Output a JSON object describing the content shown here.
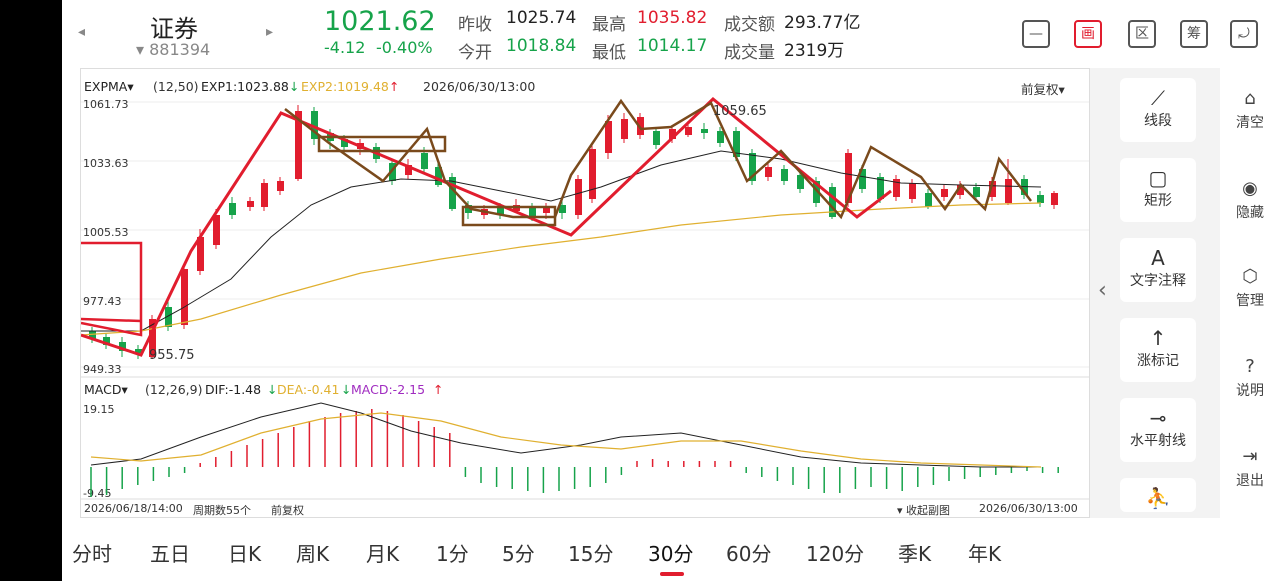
{
  "header": {
    "prev_arrow": "◂",
    "next_arrow": "▸",
    "name": "证券",
    "code": "▾ 881394",
    "price": "1021.62",
    "change": "-4.12",
    "change_pct": "-0.40%",
    "stats": [
      {
        "label": "昨收",
        "value": "1025.74",
        "color": "k"
      },
      {
        "label": "最高",
        "value": "1035.82",
        "color": "r"
      },
      {
        "label": "成交额",
        "value": "293.77亿",
        "color": "k"
      },
      {
        "label": "今开",
        "value": "1018.84",
        "color": "g"
      },
      {
        "label": "最低",
        "value": "1014.17",
        "color": "g"
      },
      {
        "label": "成交量",
        "value": "2319万",
        "color": "k"
      }
    ],
    "tools": [
      {
        "name": "minimize-icon",
        "glyph": "—"
      },
      {
        "name": "draw-icon",
        "glyph": "画"
      },
      {
        "name": "range-icon",
        "glyph": "区"
      },
      {
        "name": "chip-icon",
        "glyph": "筹"
      },
      {
        "name": "rotate-icon",
        "glyph": "⤾"
      }
    ]
  },
  "main_chart": {
    "indicator": "EXPMA▾",
    "params": "(12,50)",
    "exp1": "EXP1:1023.88",
    "exp1_arrow": "↓",
    "exp2": "EXP2:1019.48",
    "exp2_arrow": "↑",
    "datetime": "2026/06/30/13:00",
    "adjust": "前复权▾",
    "y_ticks": [
      "1061.73",
      "1033.63",
      "1005.53",
      "977.43",
      "949.33"
    ],
    "high_label": "1059.65",
    "low_label": "955.75"
  },
  "macd_chart": {
    "indicator": "MACD▾",
    "params": "(12,26,9)",
    "dif": "DIF:-1.48",
    "dif_arrow": "↓",
    "dea": "DEA:-0.41",
    "dea_arrow": "↓",
    "macd": "MACD:-2.15",
    "macd_arrow": "↑",
    "y_top": "19.15",
    "y_bottom": "-9.45"
  },
  "footer_bar": {
    "start_time": "2026/06/18/14:00",
    "period_count": "周期数55个",
    "adjust": "前复权",
    "collapse": "▾ 收起副图",
    "end_time": "2026/06/30/13:00"
  },
  "draw_tools": [
    {
      "name": "segment",
      "icon": "⟋",
      "label": "线段"
    },
    {
      "name": "rectangle",
      "icon": "▢",
      "label": "矩形"
    },
    {
      "name": "text-note",
      "icon": "A",
      "label": "文字注释"
    },
    {
      "name": "rise-mark",
      "icon": "↑",
      "label": "涨标记"
    },
    {
      "name": "horizontal-ray",
      "icon": "⊸",
      "label": "水平射线"
    },
    {
      "name": "more",
      "icon": "⛹",
      "label": ""
    }
  ],
  "draw_panel_collapse": "‹",
  "right_actions": [
    {
      "name": "clear",
      "icon": "⌂",
      "label": "清空"
    },
    {
      "name": "hide",
      "icon": "◉",
      "label": "隐藏"
    },
    {
      "name": "manage",
      "icon": "⬡",
      "label": "管理"
    },
    {
      "name": "help",
      "icon": "?",
      "label": "说明"
    },
    {
      "name": "exit",
      "icon": "⇥",
      "label": "退出"
    }
  ],
  "tabs": [
    "分时",
    "五日",
    "日K",
    "周K",
    "月K",
    "1分",
    "5分",
    "15分",
    "30分",
    "60分",
    "120分",
    "季K",
    "年K"
  ],
  "active_tab": "30分",
  "colors": {
    "up": "#e11d2e",
    "down": "#16a34a",
    "drawing": "#7a4a1c",
    "exp2": "#e0b030"
  }
}
